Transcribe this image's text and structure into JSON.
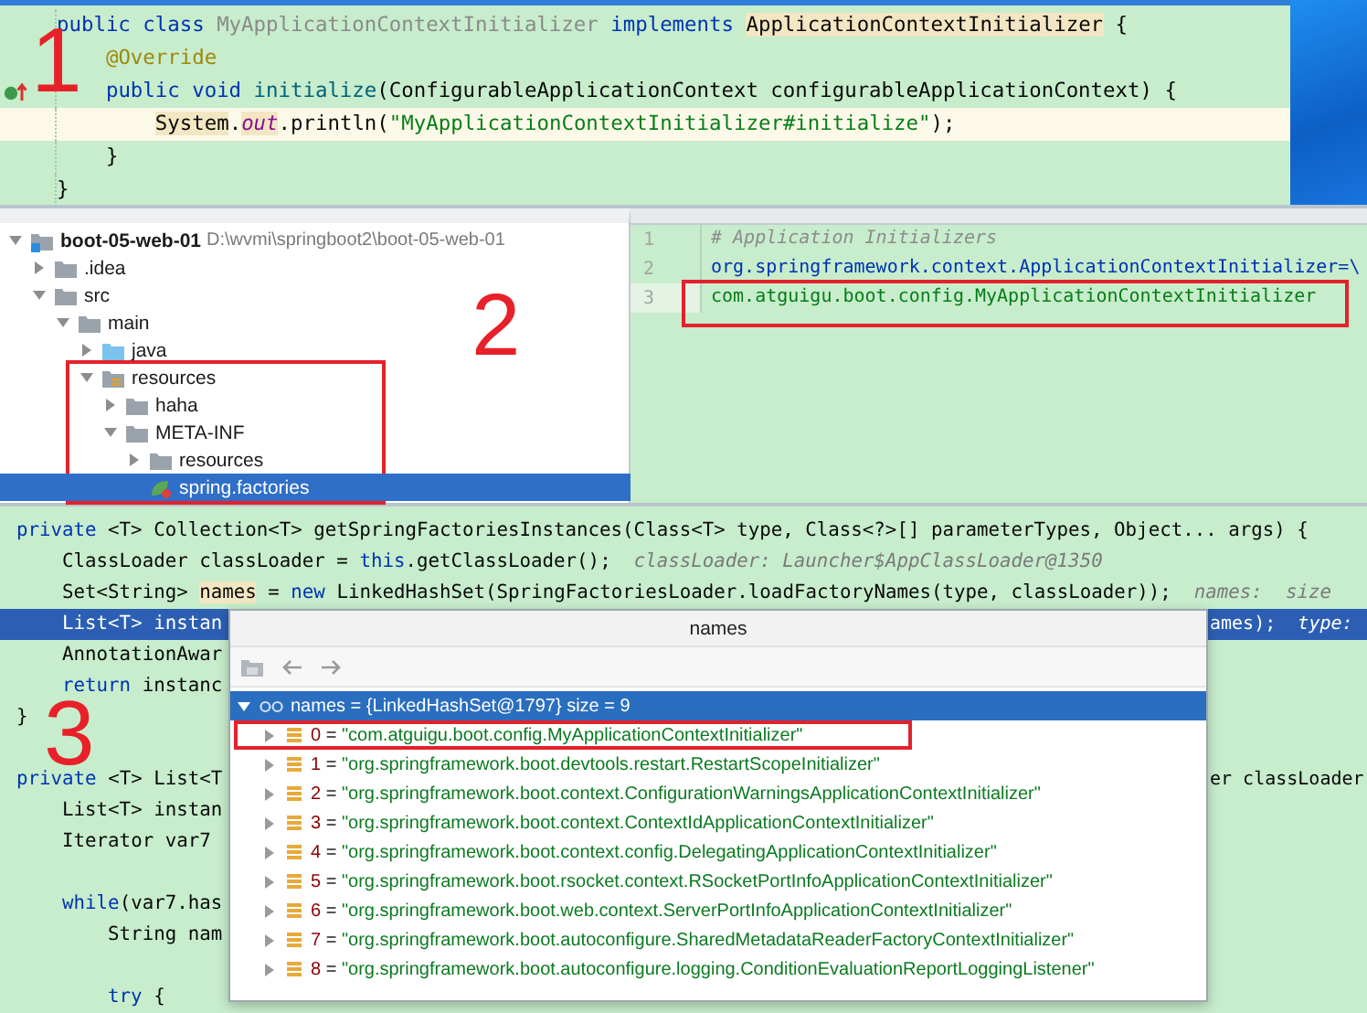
{
  "class_snippet": {
    "step": "1",
    "lines": [
      {
        "current": false,
        "override_icon": false,
        "tokens": [
          {
            "text": "public class ",
            "kind": "kw"
          },
          {
            "text": "MyApplicationContextInitializer",
            "kind": "dim"
          },
          {
            "text": " implements ",
            "kind": "kw"
          },
          {
            "text": "ApplicationContextInitializer",
            "kind": "mark"
          },
          {
            "text": " {",
            "kind": "plain"
          }
        ]
      },
      {
        "current": false,
        "override_icon": false,
        "tokens": [
          {
            "text": "    @Override",
            "kind": "ann"
          }
        ]
      },
      {
        "current": false,
        "override_icon": true,
        "tokens": [
          {
            "text": "    public void ",
            "kind": "kw"
          },
          {
            "text": "initialize",
            "kind": "method"
          },
          {
            "text": "(ConfigurableApplicationContext configurableApplicationContext) {",
            "kind": "plain"
          }
        ]
      },
      {
        "current": true,
        "override_icon": false,
        "tokens": [
          {
            "text": "        System",
            "kind": "mark"
          },
          {
            "text": ".",
            "kind": "plain"
          },
          {
            "text": "out",
            "kind": "field"
          },
          {
            "text": ".println(",
            "kind": "plain"
          },
          {
            "text": "\"MyApplicationContextInitializer#initialize\"",
            "kind": "str"
          },
          {
            "text": ");",
            "kind": "plain"
          }
        ]
      },
      {
        "current": false,
        "override_icon": false,
        "tokens": [
          {
            "text": "    }",
            "kind": "plain"
          }
        ]
      },
      {
        "current": false,
        "override_icon": false,
        "tokens": [
          {
            "text": "}",
            "kind": "plain"
          }
        ]
      }
    ]
  },
  "project_tree": {
    "step": "2",
    "items": [
      {
        "kind": "module",
        "label": "boot-05-web-01",
        "path": "D:\\wvmi\\springboot2\\boot-05-web-01",
        "expanded": true,
        "selected": false,
        "annotated": false,
        "children": [
          {
            "kind": "folder",
            "label": ".idea",
            "expanded": false,
            "selected": false,
            "annotated": false
          },
          {
            "kind": "folder",
            "label": "src",
            "expanded": true,
            "selected": false,
            "annotated": false,
            "children": [
              {
                "kind": "folder",
                "label": "main",
                "expanded": true,
                "selected": false,
                "annotated": false,
                "children": [
                  {
                    "kind": "source-folder",
                    "label": "java",
                    "expanded": false,
                    "selected": false,
                    "annotated": false
                  },
                  {
                    "kind": "resource-folder",
                    "label": "resources",
                    "expanded": true,
                    "selected": false,
                    "annotated": true,
                    "children": [
                      {
                        "kind": "folder",
                        "label": "haha",
                        "expanded": false,
                        "selected": false,
                        "annotated": false
                      },
                      {
                        "kind": "folder",
                        "label": "META-INF",
                        "expanded": true,
                        "selected": false,
                        "annotated": false,
                        "children": [
                          {
                            "kind": "folder",
                            "label": "resources",
                            "expanded": false,
                            "selected": false,
                            "annotated": false
                          },
                          {
                            "kind": "spring-file",
                            "label": "spring.factories",
                            "expanded": false,
                            "selected": true,
                            "annotated": false
                          }
                        ]
                      }
                    ]
                  }
                ]
              }
            ]
          }
        ]
      }
    ]
  },
  "factories_editor": {
    "lines": [
      {
        "number": "1",
        "current": false,
        "annotated": false,
        "tokens": [
          {
            "text": "# Application Initializers",
            "kind": "comment"
          }
        ]
      },
      {
        "number": "2",
        "current": false,
        "annotated": false,
        "tokens": [
          {
            "text": "org.springframework.context.ApplicationContextInitializer=\\",
            "kind": "key"
          }
        ]
      },
      {
        "number": "3",
        "current": true,
        "annotated": true,
        "tokens": [
          {
            "text": "com.atguigu.boot.config.MyApplicationContextInitializer",
            "kind": "str"
          }
        ]
      }
    ]
  },
  "debugger_code": {
    "step": "3",
    "lines": [
      {
        "kind": "code",
        "current": false,
        "tokens": [
          {
            "text": "private ",
            "kind": "kw"
          },
          {
            "text": "<T> Collection<T> getSpringFactoriesInstances(Class<T> type, Class<?>[] parameterTypes, Object... args) {",
            "kind": "plain"
          }
        ]
      },
      {
        "kind": "code",
        "current": false,
        "tokens": [
          {
            "text": "    ClassLoader classLoader = ",
            "kind": "plain"
          },
          {
            "text": "this",
            "kind": "kw"
          },
          {
            "text": ".getClassLoader();",
            "kind": "plain"
          },
          {
            "text": "  classLoader: Launcher$AppClassLoader@1350",
            "kind": "hint"
          }
        ]
      },
      {
        "kind": "code",
        "current": false,
        "tokens": [
          {
            "text": "    Set<String> ",
            "kind": "plain"
          },
          {
            "text": "names",
            "kind": "mark"
          },
          {
            "text": " = ",
            "kind": "plain"
          },
          {
            "text": "new",
            "kind": "kw"
          },
          {
            "text": " LinkedHashSet(SpringFactoriesLoader.loadFactoryNames(type, classLoader));",
            "kind": "plain"
          },
          {
            "text": "  names:  size",
            "kind": "hint"
          }
        ]
      },
      {
        "kind": "code",
        "current": true,
        "tokens": [
          {
            "text": "    List<T> instan",
            "kind": "plain"
          }
        ],
        "tail": [
          {
            "text": "ames);",
            "kind": "plain"
          },
          {
            "text": "  type:",
            "kind": "hint"
          }
        ]
      },
      {
        "kind": "code",
        "current": false,
        "tokens": [
          {
            "text": "    AnnotationAwar",
            "kind": "plain"
          }
        ]
      },
      {
        "kind": "code",
        "current": false,
        "tokens": [
          {
            "text": "    return",
            "kind": "kw"
          },
          {
            "text": " instanc",
            "kind": "plain"
          }
        ]
      },
      {
        "kind": "code",
        "current": false,
        "tokens": [
          {
            "text": "}",
            "kind": "plain"
          }
        ]
      },
      {
        "kind": "blank",
        "current": false
      },
      {
        "kind": "code",
        "current": false,
        "tokens": [
          {
            "text": "private",
            "kind": "kw"
          },
          {
            "text": " <T> List<T",
            "kind": "plain"
          }
        ],
        "tail": [
          {
            "text": "er classLoader",
            "kind": "plain"
          }
        ]
      },
      {
        "kind": "code",
        "current": false,
        "tokens": [
          {
            "text": "    List<T> instan",
            "kind": "plain"
          }
        ]
      },
      {
        "kind": "code",
        "current": false,
        "tokens": [
          {
            "text": "    Iterator var7",
            "kind": "plain"
          }
        ]
      },
      {
        "kind": "blank",
        "current": false
      },
      {
        "kind": "code",
        "current": false,
        "tokens": [
          {
            "text": "    while",
            "kind": "kw"
          },
          {
            "text": "(var7.has",
            "kind": "plain"
          }
        ]
      },
      {
        "kind": "code",
        "current": false,
        "tokens": [
          {
            "text": "        String nam",
            "kind": "plain"
          }
        ]
      },
      {
        "kind": "blank",
        "current": false
      },
      {
        "kind": "code",
        "current": false,
        "tokens": [
          {
            "text": "        try",
            "kind": "kw"
          },
          {
            "text": " {",
            "kind": "plain"
          }
        ]
      }
    ]
  },
  "names_popup": {
    "title": "names",
    "root": {
      "label": "names = {LinkedHashSet@1797}  size = 9",
      "expanded": true,
      "selected": true
    },
    "entries": [
      {
        "index": "0",
        "operator": "=",
        "value": "\"com.atguigu.boot.config.MyApplicationContextInitializer\"",
        "expanded": false,
        "annotated": true
      },
      {
        "index": "1",
        "operator": "=",
        "value": "\"org.springframework.boot.devtools.restart.RestartScopeInitializer\"",
        "expanded": false,
        "annotated": false
      },
      {
        "index": "2",
        "operator": "=",
        "value": "\"org.springframework.boot.context.ConfigurationWarningsApplicationContextInitializer\"",
        "expanded": false,
        "annotated": false
      },
      {
        "index": "3",
        "operator": "=",
        "value": "\"org.springframework.boot.context.ContextIdApplicationContextInitializer\"",
        "expanded": false,
        "annotated": false
      },
      {
        "index": "4",
        "operator": "=",
        "value": "\"org.springframework.boot.context.config.DelegatingApplicationContextInitializer\"",
        "expanded": false,
        "annotated": false
      },
      {
        "index": "5",
        "operator": "=",
        "value": "\"org.springframework.boot.rsocket.context.RSocketPortInfoApplicationContextInitializer\"",
        "expanded": false,
        "annotated": false
      },
      {
        "index": "6",
        "operator": "=",
        "value": "\"org.springframework.boot.web.context.ServerPortInfoApplicationContextInitializer\"",
        "expanded": false,
        "annotated": false
      },
      {
        "index": "7",
        "operator": "=",
        "value": "\"org.springframework.boot.autoconfigure.SharedMetadataReaderFactoryContextInitializer\"",
        "expanded": false,
        "annotated": false
      },
      {
        "index": "8",
        "operator": "=",
        "value": "\"org.springframework.boot.autoconfigure.logging.ConditionEvaluationReportLoggingListener\"",
        "expanded": false,
        "annotated": false
      }
    ]
  }
}
